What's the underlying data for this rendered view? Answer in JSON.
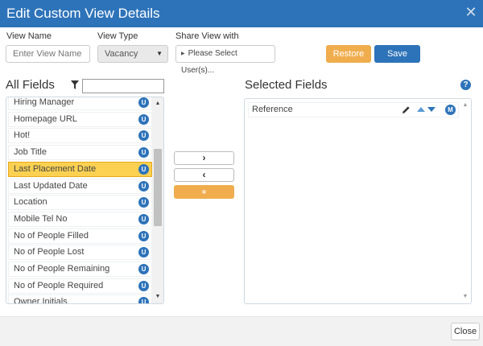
{
  "dialog": {
    "title": "Edit Custom View Details",
    "close_glyph": "✕"
  },
  "form": {
    "view_name_label": "View Name",
    "view_name_placeholder": "Enter View Name",
    "view_type_label": "View Type",
    "view_type_value": "Vacancy",
    "share_label": "Share View with",
    "share_value": "Please Select User(s)..."
  },
  "buttons": {
    "restore": "Restore",
    "save": "Save",
    "close": "Close"
  },
  "all_fields": {
    "title": "All Fields",
    "filter_value": "",
    "badge_letter": "U",
    "items": [
      "Hiring Manager",
      "Homepage URL",
      "Hot!",
      "Job Title",
      "Last Placement Date",
      "Last Updated Date",
      "Location",
      "Mobile Tel No",
      "No of People Filled",
      "No of People Lost",
      "No of People Remaining",
      "No of People Required",
      "Owner Initials"
    ],
    "selected_item": "Last Placement Date"
  },
  "transfer": {
    "add": "›",
    "remove": "‹",
    "remove_all": "«"
  },
  "selected_fields": {
    "title": "Selected Fields",
    "help_glyph": "?",
    "items": [
      {
        "label": "Reference",
        "badge_letter": "M"
      }
    ]
  },
  "colors": {
    "primary": "#2d73b9",
    "accent": "#f0ad4e",
    "highlight": "#fcd152"
  }
}
